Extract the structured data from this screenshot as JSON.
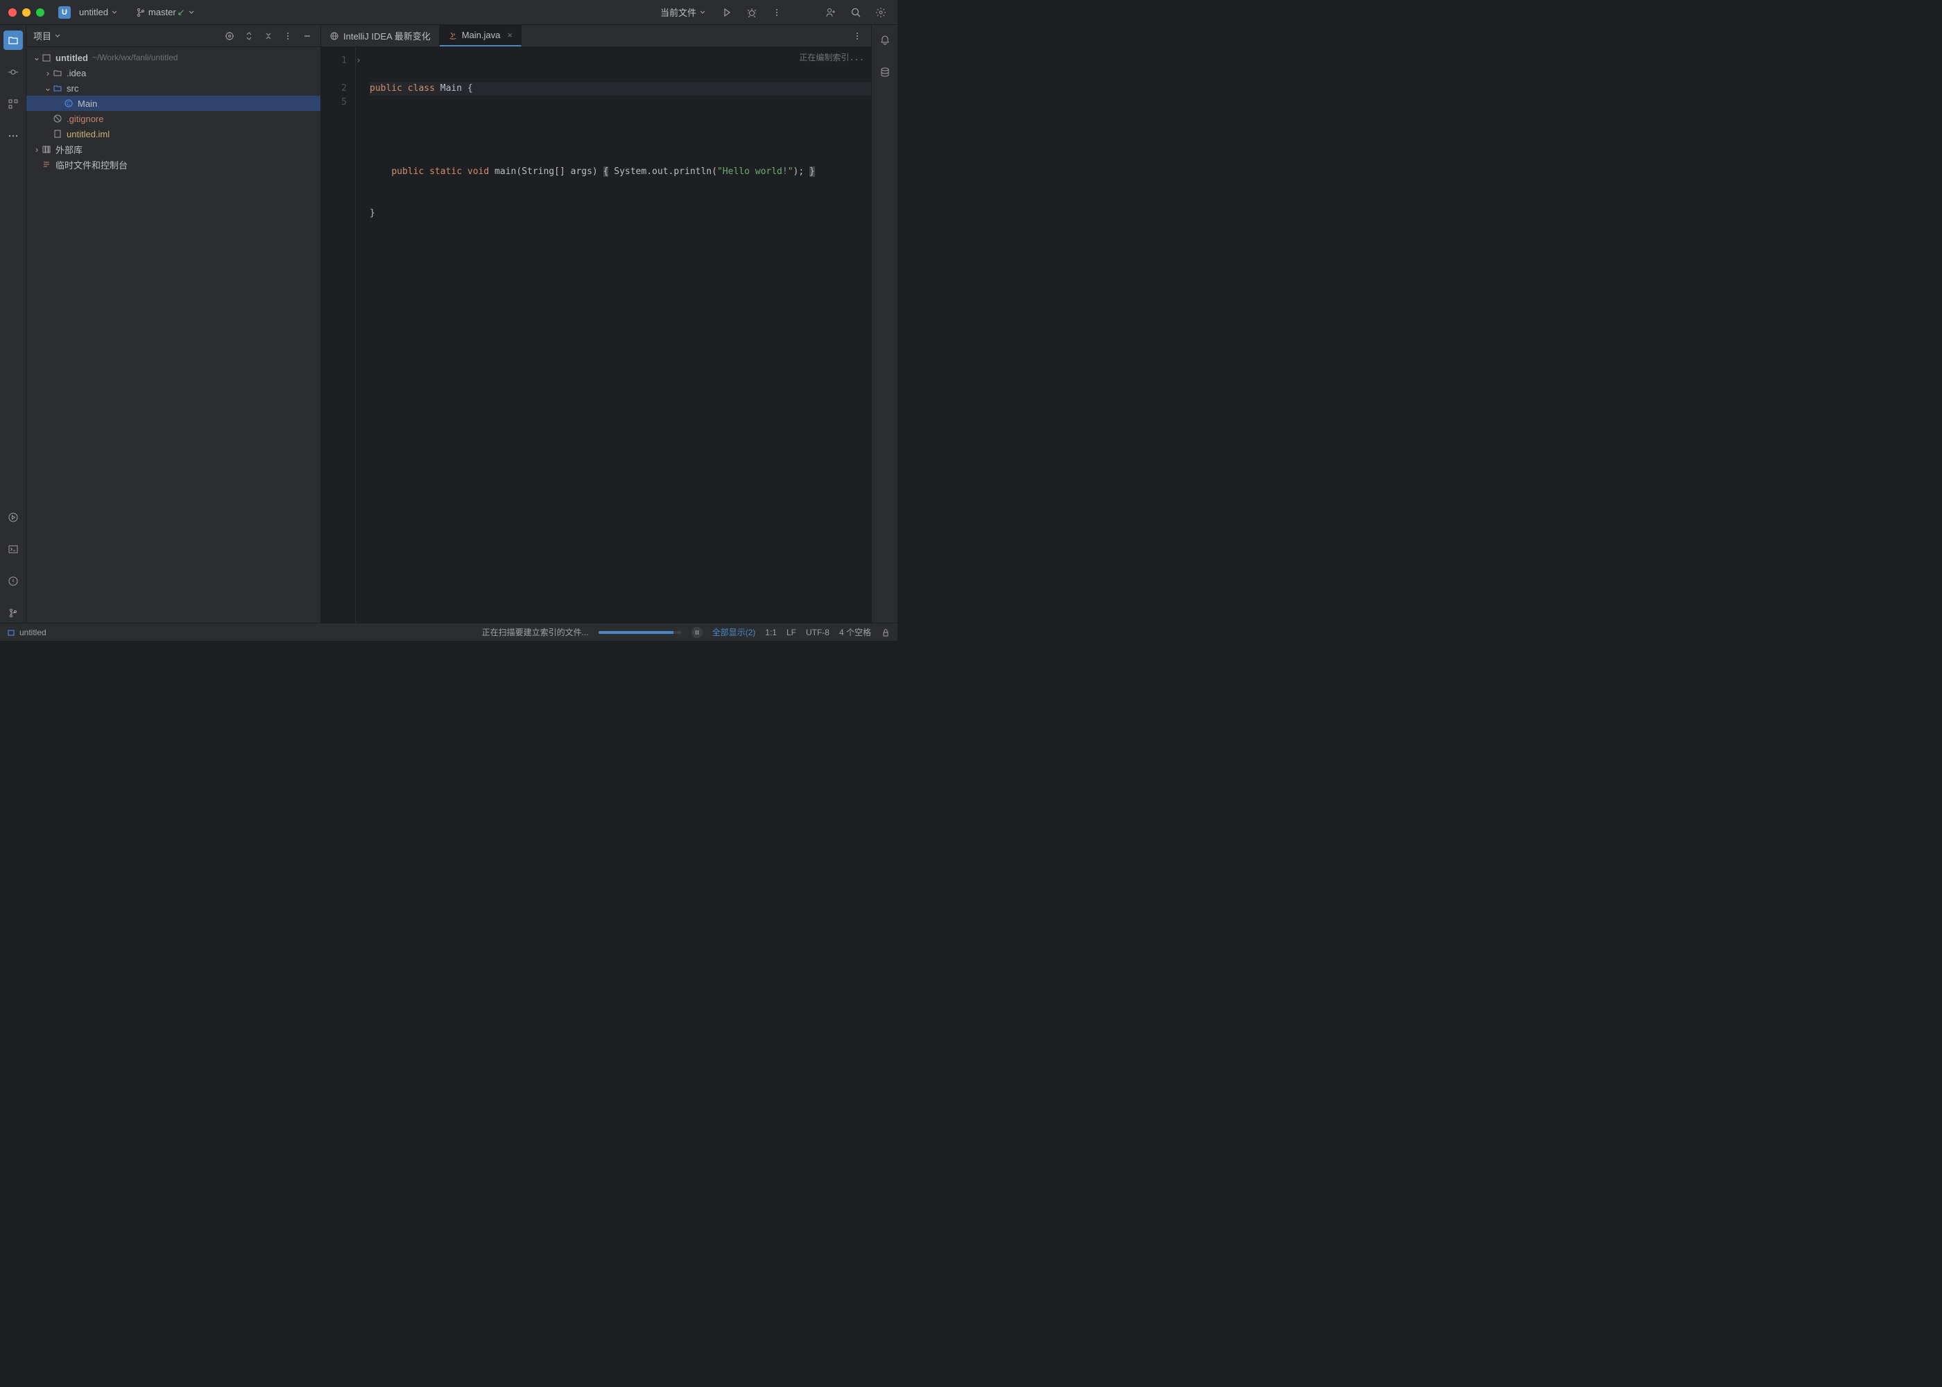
{
  "titlebar": {
    "project_badge": "U",
    "project_name": "untitled",
    "branch": "master",
    "current_file_label": "当前文件"
  },
  "project_panel": {
    "title": "项目",
    "tree": {
      "root": {
        "name": "untitled",
        "path": "~/Work/wx/fanli/untitled"
      },
      "idea": ".idea",
      "src": "src",
      "main": "Main",
      "gitignore": ".gitignore",
      "iml": "untitled.iml",
      "external": "外部库",
      "scratches": "临时文件和控制台"
    }
  },
  "tabs": {
    "whatsnew": "IntelliJ IDEA 最新变化",
    "main": "Main.java"
  },
  "editor": {
    "indexing_text": "正在编制索引...",
    "lines": {
      "l1": "public class Main {",
      "l2_pre": "    public static void main(String[] args) ",
      "l2_brace": "{",
      "l2_mid": " System.out.println(",
      "l2_str": "\"Hello world!\"",
      "l2_end": "); ",
      "l2_close": "}",
      "l5": "}"
    },
    "gutter": [
      "1",
      "2",
      "5"
    ]
  },
  "statusbar": {
    "project": "untitled",
    "scanning": "正在扫描要建立索引的文件...",
    "show_all": "全部显示(2)",
    "position": "1:1",
    "line_sep": "LF",
    "encoding": "UTF-8",
    "indent": "4 个空格"
  }
}
